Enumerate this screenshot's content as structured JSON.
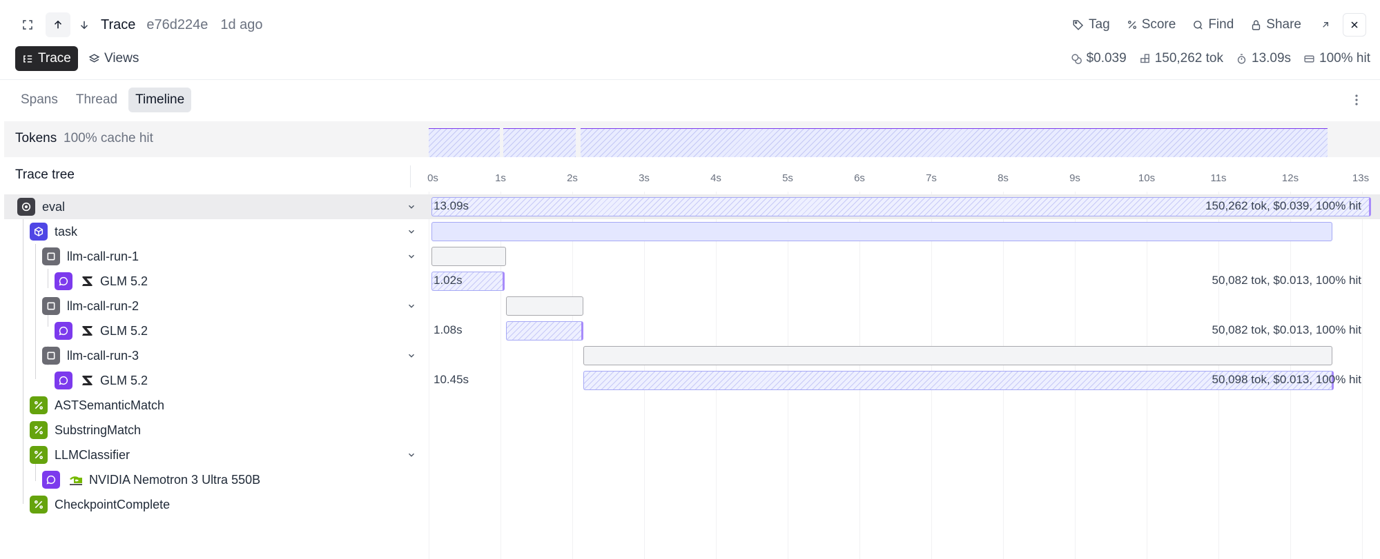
{
  "header": {
    "title": "Trace",
    "trace_id": "e76d224e",
    "time_ago": "1d ago",
    "actions": {
      "tag": "Tag",
      "score": "Score",
      "find": "Find",
      "share": "Share"
    }
  },
  "toolbar": {
    "trace_button": "Trace",
    "views_button": "Views",
    "stats": {
      "cost": "$0.039",
      "tokens": "150,262 tok",
      "duration": "13.09s",
      "cache": "100% hit"
    }
  },
  "tabs": [
    {
      "label": "Spans",
      "active": false
    },
    {
      "label": "Thread",
      "active": false
    },
    {
      "label": "Timeline",
      "active": true
    }
  ],
  "tokens_band": {
    "label": "Tokens",
    "sub": "100% cache hit"
  },
  "tree": {
    "heading": "Trace tree"
  },
  "axis": {
    "ticks": [
      "0s",
      "1s",
      "2s",
      "3s",
      "4s",
      "5s",
      "6s",
      "7s",
      "8s",
      "9s",
      "10s",
      "11s",
      "12s",
      "13s"
    ]
  },
  "spans": [
    {
      "name": "eval",
      "icon": "target-icon",
      "color": "#3f3f46",
      "depth": 0,
      "expandable": true,
      "start": 0.0,
      "duration": 13.09,
      "duration_label": "13.09s",
      "stats": "150,262 tok, $0.039, 100% hit",
      "bar": "hatch"
    },
    {
      "name": "task",
      "icon": "box-icon",
      "color": "#4f46e5",
      "depth": 1,
      "expandable": true,
      "start": 0.0,
      "duration": 12.55,
      "duration_label": "",
      "stats": "",
      "bar": "solid"
    },
    {
      "name": "llm-call-run-1",
      "icon": "square-icon",
      "color": "#6b6b73",
      "depth": 2,
      "expandable": true,
      "start": 0.0,
      "duration": 1.04,
      "duration_label": "",
      "stats": "",
      "bar": "gray"
    },
    {
      "name": "GLM 5.2",
      "icon": "chat-bubble-icon",
      "color": "#7c3aed",
      "depth": 3,
      "expandable": false,
      "provider_icon": "zhipu-logo-icon",
      "start": 0.0,
      "duration": 1.02,
      "duration_label": "1.02s",
      "stats": "50,082 tok, $0.013, 100% hit",
      "bar": "hatch"
    },
    {
      "name": "llm-call-run-2",
      "icon": "square-icon",
      "color": "#6b6b73",
      "depth": 2,
      "expandable": true,
      "start": 1.04,
      "duration": 1.08,
      "duration_label": "",
      "stats": "",
      "bar": "gray"
    },
    {
      "name": "GLM 5.2",
      "icon": "chat-bubble-icon",
      "color": "#7c3aed",
      "depth": 3,
      "expandable": false,
      "provider_icon": "zhipu-logo-icon",
      "start": 1.04,
      "duration": 1.08,
      "duration_label": "1.08s",
      "stats": "50,082 tok, $0.013, 100% hit",
      "bar": "hatch"
    },
    {
      "name": "llm-call-run-3",
      "icon": "square-icon",
      "color": "#6b6b73",
      "depth": 2,
      "expandable": true,
      "start": 2.12,
      "duration": 10.43,
      "duration_label": "",
      "stats": "",
      "bar": "gray"
    },
    {
      "name": "GLM 5.2",
      "icon": "chat-bubble-icon",
      "color": "#7c3aed",
      "depth": 3,
      "expandable": false,
      "provider_icon": "zhipu-logo-icon",
      "start": 2.12,
      "duration": 10.45,
      "duration_label": "10.45s",
      "stats": "50,098 tok, $0.013, 100% hit",
      "bar": "hatch"
    },
    {
      "name": "ASTSemanticMatch",
      "icon": "percent-icon",
      "color": "#65a30d",
      "depth": 1,
      "expandable": false
    },
    {
      "name": "SubstringMatch",
      "icon": "percent-icon",
      "color": "#65a30d",
      "depth": 1,
      "expandable": false
    },
    {
      "name": "LLMClassifier",
      "icon": "percent-icon",
      "color": "#65a30d",
      "depth": 1,
      "expandable": true
    },
    {
      "name": "NVIDIA Nemotron 3 Ultra 550B",
      "icon": "chat-bubble-icon",
      "color": "#7c3aed",
      "depth": 2,
      "expandable": false,
      "provider_icon": "nvidia-logo-icon"
    },
    {
      "name": "CheckpointComplete",
      "icon": "percent-icon",
      "color": "#65a30d",
      "depth": 1,
      "expandable": false
    }
  ],
  "token_segments": [
    {
      "start": 0.0,
      "end": 1.02
    },
    {
      "start": 1.04,
      "end": 2.08
    },
    {
      "start": 2.12,
      "end": 12.55
    }
  ],
  "timeline_max_seconds": 13
}
